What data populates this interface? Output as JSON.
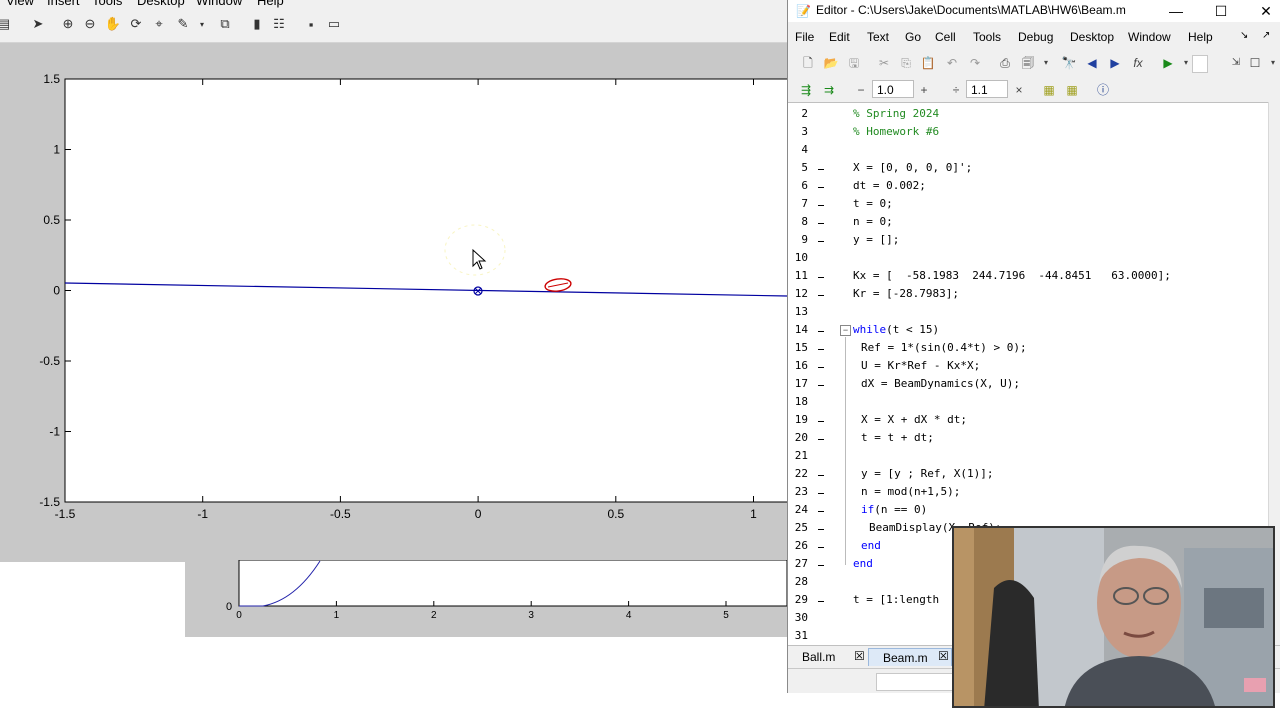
{
  "figure": {
    "menu": [
      "View",
      "Insert",
      "Tools",
      "Desktop",
      "Window",
      "Help"
    ],
    "toolbar_icons": [
      "print-icon",
      "pointer-icon",
      "zoom-in-icon",
      "zoom-out-icon",
      "pan-hand-icon",
      "rotate-3d-icon",
      "data-cursor-icon",
      "brush-icon",
      "link-plot-icon",
      "colorbar-icon",
      "legend-icon",
      "hide-plot-tools-icon",
      "show-plot-tools-icon"
    ],
    "x_ticks": [
      "-1.5",
      "-1",
      "-0.5",
      "0",
      "0.5",
      "1"
    ],
    "y_ticks": [
      "1.5",
      "1",
      "0.5",
      "0",
      "-0.5",
      "-1",
      "-1.5"
    ],
    "beam_color": "#0000a0",
    "ball_color": "#cc0000",
    "ref_marker_color": "#0000a0"
  },
  "figure2": {
    "x_ticks": [
      "0",
      "1",
      "2",
      "3",
      "4",
      "5"
    ],
    "y_tick": "0",
    "line_color": "#2222aa"
  },
  "editor": {
    "title": "Editor - C:\\Users\\Jake\\Documents\\MATLAB\\HW6\\Beam.m",
    "menu": [
      "File",
      "Edit",
      "Text",
      "Go",
      "Cell",
      "Tools",
      "Debug",
      "Desktop",
      "Window",
      "Help"
    ],
    "cell_zoom": {
      "minus": "−",
      "value1": "1.0",
      "plus": "+",
      "divide": "÷",
      "value2": "1.1",
      "times": "×"
    },
    "lines": [
      {
        "n": "2",
        "text": "% Spring 2024",
        "kind": "comment",
        "dash": false,
        "indent": 0
      },
      {
        "n": "3",
        "text": "% Homework #6",
        "kind": "comment",
        "dash": false,
        "indent": 0
      },
      {
        "n": "4",
        "text": "",
        "kind": "plain",
        "dash": false,
        "indent": 0
      },
      {
        "n": "5",
        "text": "X = [0, 0, 0, 0]';",
        "kind": "plain",
        "dash": true,
        "indent": 0
      },
      {
        "n": "6",
        "text": "dt = 0.002;",
        "kind": "plain",
        "dash": true,
        "indent": 0
      },
      {
        "n": "7",
        "text": "t = 0;",
        "kind": "plain",
        "dash": true,
        "indent": 0
      },
      {
        "n": "8",
        "text": "n = 0;",
        "kind": "plain",
        "dash": true,
        "indent": 0
      },
      {
        "n": "9",
        "text": "y = [];",
        "kind": "plain",
        "dash": true,
        "indent": 0
      },
      {
        "n": "10",
        "text": "",
        "kind": "plain",
        "dash": false,
        "indent": 0
      },
      {
        "n": "11",
        "text": "Kx = [  -58.1983  244.7196  -44.8451   63.0000];",
        "kind": "plain",
        "dash": true,
        "indent": 0
      },
      {
        "n": "12",
        "text": "Kr = [-28.7983];",
        "kind": "plain",
        "dash": true,
        "indent": 0
      },
      {
        "n": "13",
        "text": "",
        "kind": "plain",
        "dash": false,
        "indent": 0
      },
      {
        "n": "14",
        "text": "while(t < 15)",
        "kind": "while",
        "dash": true,
        "indent": 0
      },
      {
        "n": "15",
        "text": "Ref = 1*(sin(0.4*t) > 0);",
        "kind": "plain",
        "dash": true,
        "indent": 1
      },
      {
        "n": "16",
        "text": "U = Kr*Ref - Kx*X;",
        "kind": "plain",
        "dash": true,
        "indent": 1
      },
      {
        "n": "17",
        "text": "dX = BeamDynamics(X, U);",
        "kind": "plain",
        "dash": true,
        "indent": 1
      },
      {
        "n": "18",
        "text": "",
        "kind": "plain",
        "dash": false,
        "indent": 0
      },
      {
        "n": "19",
        "text": "X = X + dX * dt;",
        "kind": "plain",
        "dash": true,
        "indent": 1
      },
      {
        "n": "20",
        "text": "t = t + dt;",
        "kind": "plain",
        "dash": true,
        "indent": 1
      },
      {
        "n": "21",
        "text": "",
        "kind": "plain",
        "dash": false,
        "indent": 0
      },
      {
        "n": "22",
        "text": "y = [y ; Ref, X(1)];",
        "kind": "plain",
        "dash": true,
        "indent": 1
      },
      {
        "n": "23",
        "text": "n = mod(n+1,5);",
        "kind": "plain",
        "dash": true,
        "indent": 1
      },
      {
        "n": "24",
        "text": "if(n == 0)",
        "kind": "if",
        "dash": true,
        "indent": 1
      },
      {
        "n": "25",
        "text": "BeamDisplay(X, Ref);",
        "kind": "plain",
        "dash": true,
        "indent": 2
      },
      {
        "n": "26",
        "text": "end",
        "kind": "keyword",
        "dash": true,
        "indent": 1
      },
      {
        "n": "27",
        "text": "end",
        "kind": "keyword",
        "dash": true,
        "indent": 0
      },
      {
        "n": "28",
        "text": "",
        "kind": "plain",
        "dash": false,
        "indent": 0
      },
      {
        "n": "29",
        "text": "t = [1:length",
        "kind": "plain",
        "dash": true,
        "indent": 0
      },
      {
        "n": "30",
        "text": "",
        "kind": "plain",
        "dash": false,
        "indent": 0
      },
      {
        "n": "31",
        "text": "",
        "kind": "plain",
        "dash": false,
        "indent": 0
      }
    ],
    "tabs": [
      {
        "label": "Ball.m",
        "active": false
      },
      {
        "label": "Beam.m",
        "active": true
      }
    ],
    "colors": {
      "comment": "#228b22",
      "keyword": "#0000ff"
    }
  }
}
